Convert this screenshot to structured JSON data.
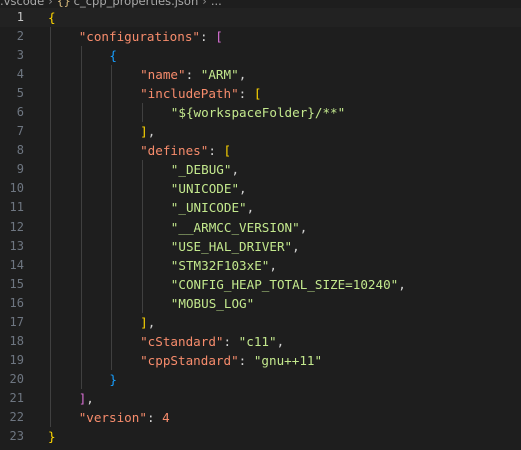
{
  "breadcrumb": {
    "parent": ".vscode",
    "file": "c_cpp_properties.json",
    "section": "..."
  },
  "lines": [
    {
      "n": "1",
      "indent": 0,
      "tokens": [
        {
          "t": "{",
          "c": "tok-brace-gold"
        }
      ]
    },
    {
      "n": "2",
      "indent": 1,
      "tokens": [
        {
          "t": "\"configurations\"",
          "c": "tok-key"
        },
        {
          "t": ": ",
          "c": "tok-default"
        },
        {
          "t": "[",
          "c": "tok-brace-violet"
        }
      ]
    },
    {
      "n": "3",
      "indent": 2,
      "tokens": [
        {
          "t": "{",
          "c": "tok-brace-blue"
        }
      ]
    },
    {
      "n": "4",
      "indent": 3,
      "tokens": [
        {
          "t": "\"name\"",
          "c": "tok-key"
        },
        {
          "t": ": ",
          "c": "tok-default"
        },
        {
          "t": "\"ARM\"",
          "c": "tok-str"
        },
        {
          "t": ",",
          "c": "tok-default"
        }
      ]
    },
    {
      "n": "5",
      "indent": 3,
      "tokens": [
        {
          "t": "\"includePath\"",
          "c": "tok-key"
        },
        {
          "t": ": ",
          "c": "tok-default"
        },
        {
          "t": "[",
          "c": "tok-brace-gold"
        }
      ]
    },
    {
      "n": "6",
      "indent": 4,
      "tokens": [
        {
          "t": "\"${workspaceFolder}/**\"",
          "c": "tok-str"
        }
      ]
    },
    {
      "n": "7",
      "indent": 3,
      "tokens": [
        {
          "t": "]",
          "c": "tok-brace-gold"
        },
        {
          "t": ",",
          "c": "tok-default"
        }
      ]
    },
    {
      "n": "8",
      "indent": 3,
      "tokens": [
        {
          "t": "\"defines\"",
          "c": "tok-key"
        },
        {
          "t": ": ",
          "c": "tok-default"
        },
        {
          "t": "[",
          "c": "tok-brace-gold"
        }
      ]
    },
    {
      "n": "9",
      "indent": 4,
      "tokens": [
        {
          "t": "\"_DEBUG\"",
          "c": "tok-str"
        },
        {
          "t": ",",
          "c": "tok-default"
        }
      ]
    },
    {
      "n": "10",
      "indent": 4,
      "tokens": [
        {
          "t": "\"UNICODE\"",
          "c": "tok-str"
        },
        {
          "t": ",",
          "c": "tok-default"
        }
      ]
    },
    {
      "n": "11",
      "indent": 4,
      "tokens": [
        {
          "t": "\"_UNICODE\"",
          "c": "tok-str"
        },
        {
          "t": ",",
          "c": "tok-default"
        }
      ]
    },
    {
      "n": "12",
      "indent": 4,
      "tokens": [
        {
          "t": "\"__ARMCC_VERSION\"",
          "c": "tok-str"
        },
        {
          "t": ",",
          "c": "tok-default"
        }
      ]
    },
    {
      "n": "13",
      "indent": 4,
      "tokens": [
        {
          "t": "\"USE_HAL_DRIVER\"",
          "c": "tok-str"
        },
        {
          "t": ",",
          "c": "tok-default"
        }
      ]
    },
    {
      "n": "14",
      "indent": 4,
      "tokens": [
        {
          "t": "\"STM32F103xE\"",
          "c": "tok-str"
        },
        {
          "t": ",",
          "c": "tok-default"
        }
      ]
    },
    {
      "n": "15",
      "indent": 4,
      "tokens": [
        {
          "t": "\"CONFIG_HEAP_TOTAL_SIZE=10240\"",
          "c": "tok-str"
        },
        {
          "t": ",",
          "c": "tok-default"
        }
      ]
    },
    {
      "n": "16",
      "indent": 4,
      "tokens": [
        {
          "t": "\"MOBUS_LOG\"",
          "c": "tok-str"
        }
      ]
    },
    {
      "n": "17",
      "indent": 3,
      "tokens": [
        {
          "t": "]",
          "c": "tok-brace-gold"
        },
        {
          "t": ",",
          "c": "tok-default"
        }
      ]
    },
    {
      "n": "18",
      "indent": 3,
      "tokens": [
        {
          "t": "\"cStandard\"",
          "c": "tok-key"
        },
        {
          "t": ": ",
          "c": "tok-default"
        },
        {
          "t": "\"c11\"",
          "c": "tok-str"
        },
        {
          "t": ",",
          "c": "tok-default"
        }
      ]
    },
    {
      "n": "19",
      "indent": 3,
      "tokens": [
        {
          "t": "\"cppStandard\"",
          "c": "tok-key"
        },
        {
          "t": ": ",
          "c": "tok-default"
        },
        {
          "t": "\"gnu++11\"",
          "c": "tok-str"
        }
      ]
    },
    {
      "n": "20",
      "indent": 2,
      "tokens": [
        {
          "t": "}",
          "c": "tok-brace-blue"
        }
      ]
    },
    {
      "n": "21",
      "indent": 1,
      "tokens": [
        {
          "t": "]",
          "c": "tok-brace-violet"
        },
        {
          "t": ",",
          "c": "tok-default"
        }
      ]
    },
    {
      "n": "22",
      "indent": 1,
      "tokens": [
        {
          "t": "\"version\"",
          "c": "tok-key"
        },
        {
          "t": ": ",
          "c": "tok-default"
        },
        {
          "t": "4",
          "c": "tok-num"
        }
      ]
    },
    {
      "n": "23",
      "indent": 0,
      "tokens": [
        {
          "t": "}",
          "c": "tok-brace-gold"
        }
      ]
    }
  ],
  "current_line": "1",
  "colors": {
    "background": "#1e1e1e",
    "key": "#f78c6c",
    "string": "#c3e88d",
    "number": "#f78c6c",
    "bracket_gold": "#ffd700",
    "bracket_violet": "#da70d6",
    "bracket_blue": "#179fff",
    "line_number": "#6e7681"
  }
}
